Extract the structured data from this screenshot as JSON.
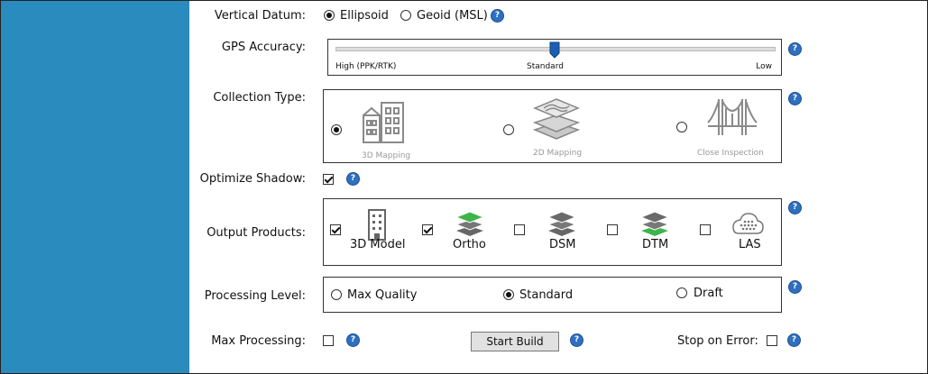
{
  "vertical_datum": {
    "label": "Vertical Datum:",
    "options": [
      "Ellipsoid",
      "Geoid (MSL)"
    ],
    "selected": 0
  },
  "gps_accuracy": {
    "label": "GPS Accuracy:",
    "min_label": "High (PPK/RTK)",
    "mid_label": "Standard",
    "max_label": "Low",
    "value": 0.5
  },
  "collection_type": {
    "label": "Collection Type:",
    "options": [
      {
        "label": "3D Mapping",
        "icon": "building-icon",
        "selected": true
      },
      {
        "label": "2D Mapping",
        "icon": "map-layers-icon",
        "selected": false
      },
      {
        "label": "Close Inspection",
        "icon": "bridge-icon",
        "selected": false
      }
    ]
  },
  "optimize_shadow": {
    "label": "Optimize Shadow:",
    "checked": true
  },
  "output_products": {
    "label": "Output Products:",
    "items": [
      {
        "label": "3D Model",
        "icon": "building-icon",
        "checked": true
      },
      {
        "label": "Ortho",
        "icon": "layers-green-top-icon",
        "checked": true
      },
      {
        "label": "DSM",
        "icon": "layers-gray-icon",
        "checked": false
      },
      {
        "label": "DTM",
        "icon": "layers-green-bottom-icon",
        "checked": false
      },
      {
        "label": "LAS",
        "icon": "cloud-points-icon",
        "checked": false
      }
    ]
  },
  "processing_level": {
    "label": "Processing Level:",
    "options": [
      "Max Quality",
      "Standard",
      "Draft"
    ],
    "selected": 1
  },
  "max_processing": {
    "label": "Max Processing:",
    "checked": false
  },
  "start_build": {
    "label": "Start Build"
  },
  "stop_on_error": {
    "label": "Stop on Error:",
    "checked": false
  },
  "help_glyph": "?",
  "colors": {
    "sidebar": "#2a8bbf",
    "help": "#2f6fc0",
    "green": "#3db54a"
  }
}
